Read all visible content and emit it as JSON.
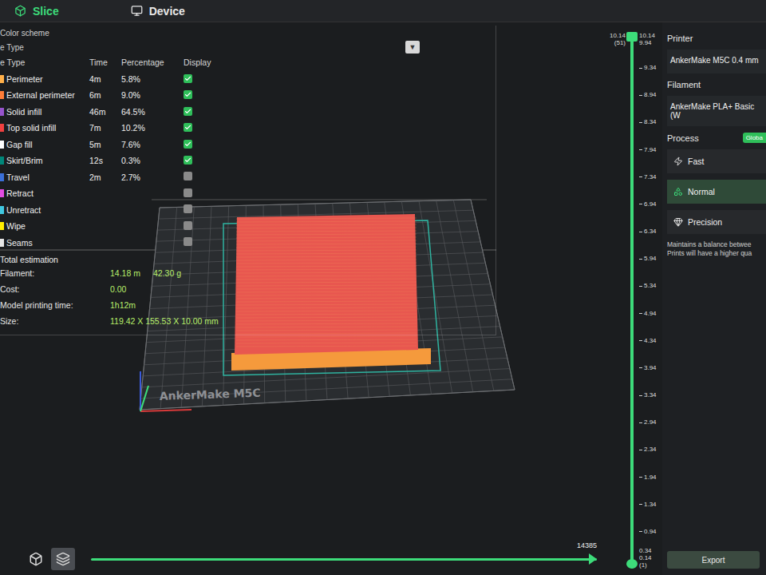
{
  "tabs": [
    {
      "label": "Slice",
      "selected": true
    },
    {
      "label": "Device",
      "selected": false
    }
  ],
  "legend": {
    "scheme_label": "Color scheme",
    "type_label": "e Type",
    "dropdown": "▼",
    "columns": [
      "e Type",
      "Time",
      "Percentage",
      "Display"
    ],
    "rows": [
      {
        "name": "Perimeter",
        "time": "4m",
        "percentage": "5.8%",
        "checked": true,
        "color": "#ffb04a"
      },
      {
        "name": "External perimeter",
        "time": "6m",
        "percentage": "9.0%",
        "checked": true,
        "color": "#ff7d38"
      },
      {
        "name": "Solid infill",
        "time": "46m",
        "percentage": "64.5%",
        "checked": true,
        "color": "#9654cc"
      },
      {
        "name": "Top solid infill",
        "time": "7m",
        "percentage": "10.2%",
        "checked": true,
        "color": "#f04040"
      },
      {
        "name": "Gap fill",
        "time": "5m",
        "percentage": "7.6%",
        "checked": true,
        "color": "#ffffff"
      },
      {
        "name": "Skirt/Brim",
        "time": "12s",
        "percentage": "0.3%",
        "checked": true,
        "color": "#00877a"
      },
      {
        "name": "Travel",
        "time": "2m",
        "percentage": "2.7%",
        "checked": false,
        "color": "#3a6fd8"
      },
      {
        "name": "Retract",
        "time": "",
        "percentage": "",
        "checked": false,
        "color": "#e24de2"
      },
      {
        "name": "Unretract",
        "time": "",
        "percentage": "",
        "checked": false,
        "color": "#40c8e0"
      },
      {
        "name": "Wipe",
        "time": "",
        "percentage": "",
        "checked": false,
        "color": "#ffee00"
      },
      {
        "name": "Seams",
        "time": "",
        "percentage": "",
        "checked": false,
        "color": "#e6e6e6"
      }
    ],
    "total_label": "Total estimation",
    "stats": [
      {
        "label": "Filament:",
        "values": [
          "14.18 m",
          "42.30 g"
        ]
      },
      {
        "label": "Cost:",
        "values": [
          "0.00"
        ]
      },
      {
        "label": "Model printing time:",
        "values": [
          "1h12m"
        ]
      },
      {
        "label": "Size:",
        "values": [
          "119.42 X 155.53 X 10.00 mm"
        ]
      }
    ]
  },
  "bed_label": "AnkerMake M5C",
  "layer_slider": {
    "top_left": [
      "10.14",
      "(51)"
    ],
    "top_right": [
      "10.14",
      "9.94"
    ],
    "ticks": [
      "9.34",
      "8.94",
      "8.34",
      "7.94",
      "7.34",
      "6.94",
      "6.34",
      "5.94",
      "5.34",
      "4.94",
      "4.34",
      "3.94",
      "3.34",
      "2.94",
      "2.34",
      "1.94",
      "1.34",
      "0.94"
    ],
    "bottom_right": [
      "0.34",
      "0.14",
      "(1)"
    ],
    "upper_level": 1,
    "lower_level": 0
  },
  "move_slider": {
    "reading": "14385",
    "level": 1
  },
  "view_buttons": [
    {
      "kind": "model",
      "selected": false
    },
    {
      "kind": "layers",
      "selected": true
    }
  ],
  "panel": {
    "printer_label": "Printer",
    "printer": "AnkerMake M5C 0.4 mm",
    "filament_label": "Filament",
    "filament": "AnkerMake PLA+ Basic (W",
    "process_label": "Process",
    "process_badge": "Globa",
    "presets": [
      {
        "label": "Fast",
        "selected": false,
        "kind": "fast"
      },
      {
        "label": "Normal",
        "selected": true,
        "kind": "normal"
      },
      {
        "label": "Precision",
        "selected": false,
        "kind": "precision"
      }
    ],
    "description": [
      "Maintains a balance betwee",
      "Prints will have a higher qua"
    ],
    "export": "Export"
  }
}
